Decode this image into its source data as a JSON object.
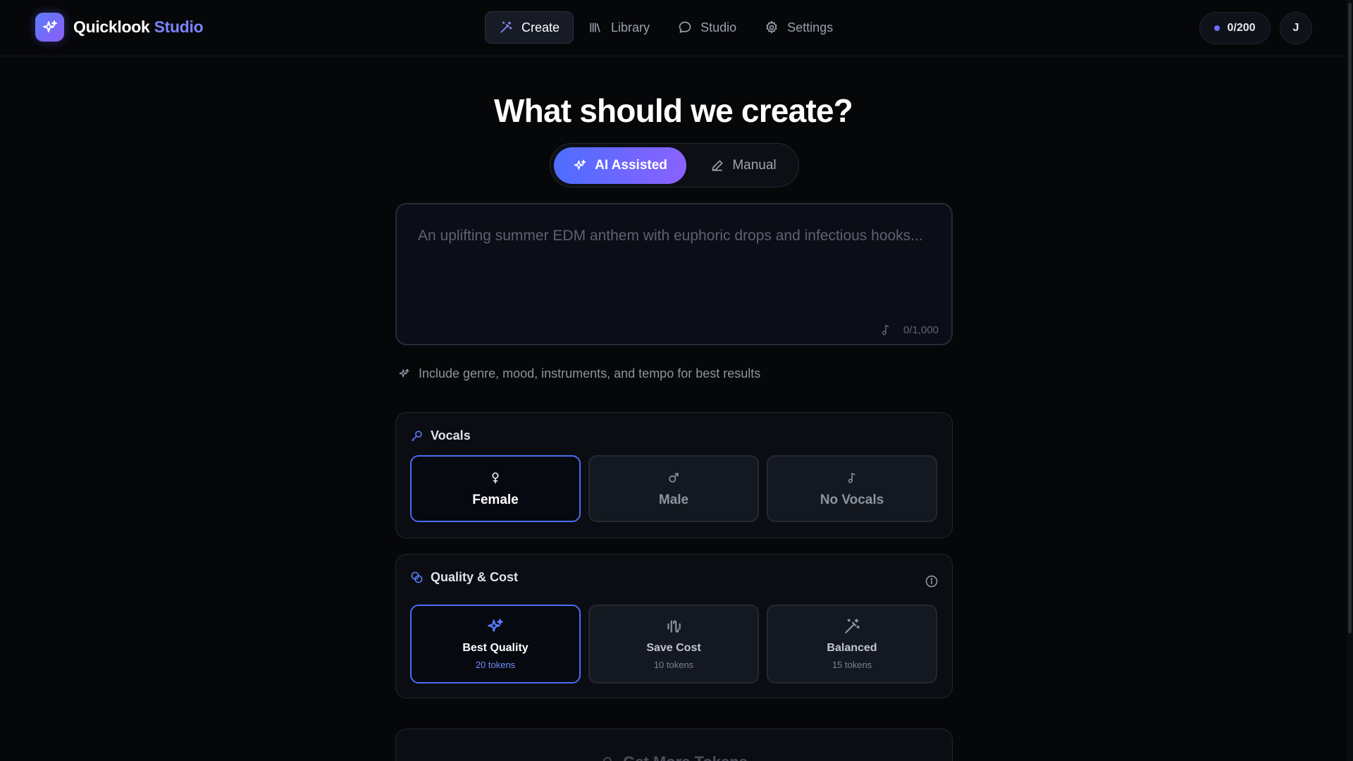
{
  "app": {
    "name": "Quicklook",
    "name_accent": "Studio"
  },
  "nav": {
    "items": [
      {
        "label": "Create",
        "icon": "magic-wand-icon",
        "active": true
      },
      {
        "label": "Library",
        "icon": "library-icon",
        "active": false
      },
      {
        "label": "Studio",
        "icon": "chat-bubble-icon",
        "active": false
      },
      {
        "label": "Settings",
        "icon": "gear-icon",
        "active": false
      }
    ]
  },
  "user": {
    "tokens": "0/200",
    "initial": "J"
  },
  "headline": "What should we create?",
  "mode": {
    "ai_label": "AI Assisted",
    "manual_label": "Manual",
    "selected": "AI Assisted"
  },
  "prompt": {
    "value": "",
    "placeholder": "An uplifting summer EDM anthem with euphoric drops and infectious hooks...",
    "counter": "0/1,000"
  },
  "tip": "Include genre, mood, instruments, and tempo for best results",
  "vocals": {
    "title": "Vocals",
    "options": [
      {
        "label": "Female",
        "icon": "female-icon",
        "selected": true
      },
      {
        "label": "Male",
        "icon": "male-icon",
        "selected": false
      },
      {
        "label": "No Vocals",
        "icon": "music-note-icon",
        "selected": false
      }
    ]
  },
  "quality": {
    "title": "Quality & Cost",
    "options": [
      {
        "label": "Best Quality",
        "cost": "20 tokens",
        "icon": "sparkles-icon",
        "selected": true
      },
      {
        "label": "Save Cost",
        "cost": "10 tokens",
        "icon": "waveform-icon",
        "selected": false
      },
      {
        "label": "Balanced",
        "cost": "15 tokens",
        "icon": "magic-wand-icon",
        "selected": false
      }
    ]
  },
  "next_panel": {
    "title": "Get More Tokens"
  },
  "colors": {
    "accent": "#4d6cf0",
    "accent_gradient_start": "#4d6dff",
    "accent_gradient_end": "#8a62ff",
    "background": "#060709"
  }
}
